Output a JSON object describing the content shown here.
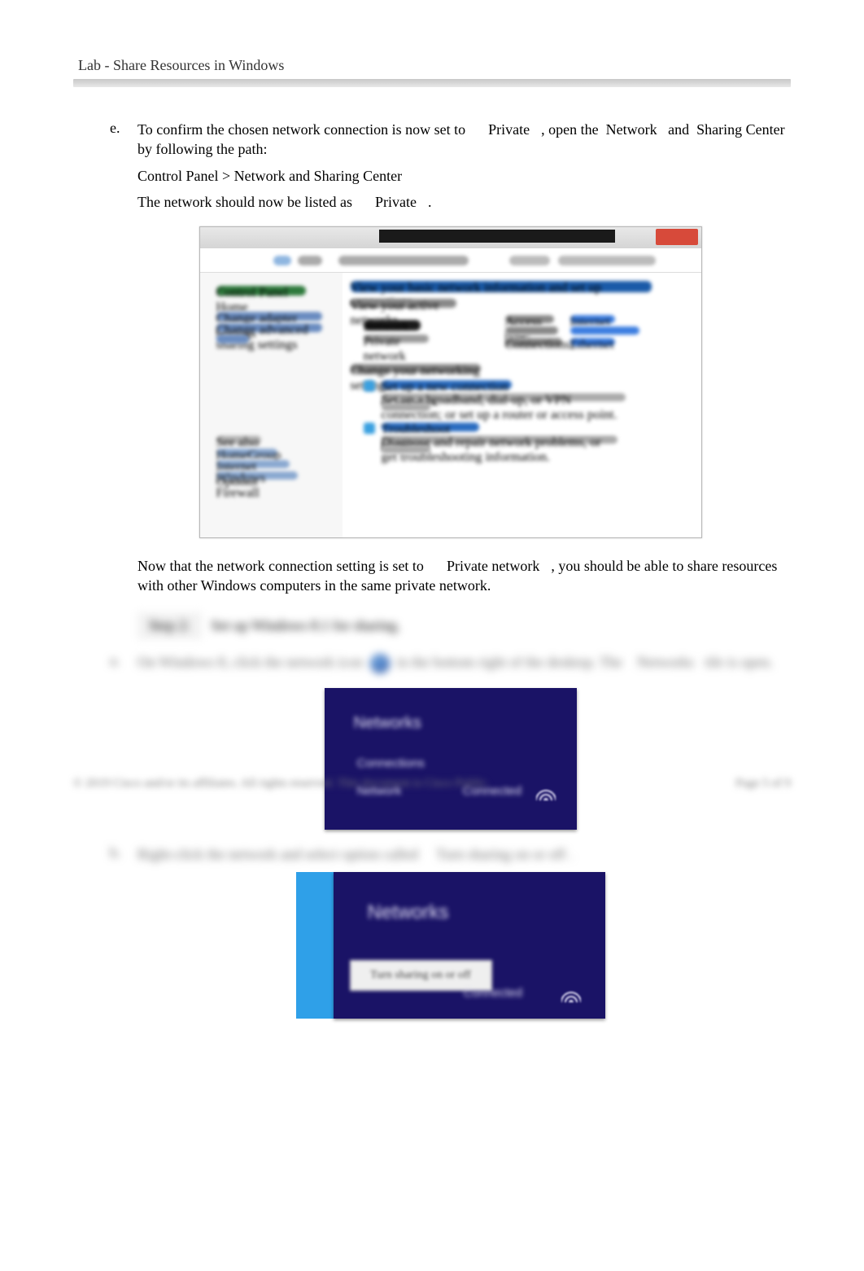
{
  "header": {
    "title": "Lab - Share Resources in Windows"
  },
  "main": {
    "step_e": {
      "marker": "e.",
      "line1a": "To confirm the chosen network connection is now set to",
      "line1b": "Private",
      "line1c": ", open the",
      "line1d": "Network",
      "line1e": "and",
      "line1f": "Sharing Center",
      "line2": "by following the path:",
      "path": "Control Panel > Network and Sharing Center",
      "line3a": "The network should now be listed as",
      "line3b": "Private",
      "line3c": "."
    },
    "para2a": "Now that the network connection setting is set to",
    "para2b": "Private network",
    "para2c": ", you should be able to share resources with other Windows computers in the same private network.",
    "step2_label": "Step 2:",
    "step2_text": "Set up Windows 8.1 for sharing.",
    "step_a": {
      "marker": "a.",
      "text1": "On Windows 8, click the network icon",
      "text2": "in the bottom right of the desktop. The",
      "text3": "Networks",
      "text4": "tile is open."
    },
    "step_b": {
      "marker": "b.",
      "text1": "Right-click the network and select option called",
      "text2": "Turn sharing on or off"
    },
    "fig2": {
      "title": "Networks",
      "sub": "Connections",
      "net": "Network",
      "conn": "Connected"
    },
    "fig3": {
      "title": "Networks",
      "ctx": "Turn sharing on or off",
      "conn": "Connected"
    },
    "fig1": {
      "heading": "View your basic network information and set up connections",
      "active": "View your active networks",
      "network_name": "Network",
      "network_type": "Private network",
      "access_label": "Access type:",
      "access_value": "Internet",
      "conn_label": "Connections:",
      "conn_value": "Ethernet",
      "change_heading": "Change your networking settings",
      "setup_link": "Set up a new connection or network",
      "setup_desc": "Set up a broadband, dial-up, or VPN connection; or set up a router or access point.",
      "trouble_link": "Troubleshoot problems",
      "trouble_desc": "Diagnose and repair network problems, or get troubleshooting information.",
      "left_cp_home": "Control Panel Home",
      "left_adapter": "Change adapter settings",
      "left_sharing": "Change advanced sharing settings",
      "left_seealso": "See also",
      "left_homegroup": "HomeGroup",
      "left_internet": "Internet Options",
      "left_firewall": "Windows Firewall"
    }
  },
  "footer": {
    "left": "© 2019 Cisco and/or its affiliates. All rights reserved. This document is Cisco Public.",
    "right": "Page 5 of 9"
  }
}
